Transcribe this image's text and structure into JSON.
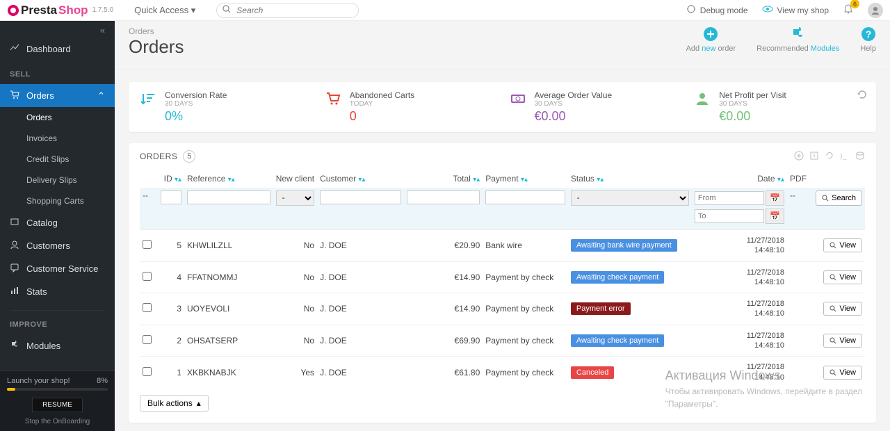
{
  "version": "1.7.5.0",
  "quick_access": "Quick Access",
  "search_placeholder": "Search",
  "topright": {
    "debug": "Debug mode",
    "view_shop": "View my shop",
    "notif_count": "6"
  },
  "sidebar": {
    "dashboard": "Dashboard",
    "sell_header": "SELL",
    "orders": "Orders",
    "orders_sub": [
      "Orders",
      "Invoices",
      "Credit Slips",
      "Delivery Slips",
      "Shopping Carts"
    ],
    "catalog": "Catalog",
    "customers": "Customers",
    "customer_service": "Customer Service",
    "stats": "Stats",
    "improve_header": "IMPROVE",
    "modules": "Modules",
    "launch": "Launch your shop!",
    "launch_pct": "8%",
    "resume": "RESUME",
    "stop": "Stop the OnBoarding"
  },
  "breadcrumb": "Orders",
  "page_title": "Orders",
  "header_actions": {
    "add_pre": "Add ",
    "add_em": "new ",
    "add_post": "order",
    "rec_pre": "Recommended ",
    "rec_em": "Modules",
    "help": "Help"
  },
  "stats": [
    {
      "title": "Conversion Rate",
      "period": "30 DAYS",
      "val": "0%",
      "color": "#25b9d7"
    },
    {
      "title": "Abandoned Carts",
      "period": "TODAY",
      "val": "0",
      "color": "#ea4335"
    },
    {
      "title": "Average Order Value",
      "period": "30 DAYS",
      "val": "€0.00",
      "color": "#9b59b6"
    },
    {
      "title": "Net Profit per Visit",
      "period": "30 DAYS",
      "val": "€0.00",
      "color": "#72c279"
    }
  ],
  "orders_card": {
    "title": "ORDERS",
    "count": "5",
    "columns": {
      "id": "ID",
      "ref": "Reference",
      "new_client": "New client",
      "customer": "Customer",
      "total": "Total",
      "payment": "Payment",
      "status": "Status",
      "date": "Date",
      "pdf": "PDF"
    },
    "filters": {
      "from": "From",
      "to": "To",
      "search": "Search",
      "dash": "-",
      "dot": "--"
    },
    "view": "View",
    "bulk": "Bulk actions",
    "rows": [
      {
        "id": "5",
        "ref": "KHWLILZLL",
        "nc": "No",
        "cust": "J. DOE",
        "total": "€20.90",
        "pay": "Bank wire",
        "status": "Awaiting bank wire payment",
        "scolor": "#4a90e2",
        "d1": "11/27/2018",
        "d2": "14:48:10"
      },
      {
        "id": "4",
        "ref": "FFATNOMMJ",
        "nc": "No",
        "cust": "J. DOE",
        "total": "€14.90",
        "pay": "Payment by check",
        "status": "Awaiting check payment",
        "scolor": "#4a90e2",
        "d1": "11/27/2018",
        "d2": "14:48:10"
      },
      {
        "id": "3",
        "ref": "UOYEVOLI",
        "nc": "No",
        "cust": "J. DOE",
        "total": "€14.90",
        "pay": "Payment by check",
        "status": "Payment error",
        "scolor": "#8b1a1a",
        "d1": "11/27/2018",
        "d2": "14:48:10"
      },
      {
        "id": "2",
        "ref": "OHSATSERP",
        "nc": "No",
        "cust": "J. DOE",
        "total": "€69.90",
        "pay": "Payment by check",
        "status": "Awaiting check payment",
        "scolor": "#4a90e2",
        "d1": "11/27/2018",
        "d2": "14:48:10"
      },
      {
        "id": "1",
        "ref": "XKBKNABJK",
        "nc": "Yes",
        "cust": "J. DOE",
        "total": "€61.80",
        "pay": "Payment by check",
        "status": "Canceled",
        "scolor": "#e84545",
        "d1": "11/27/2018",
        "d2": "14:48:10"
      }
    ]
  },
  "watermark": {
    "h": "Активация Windows",
    "l1": "Чтобы активировать Windows, перейдите в раздел",
    "l2": "\"Параметры\"."
  }
}
